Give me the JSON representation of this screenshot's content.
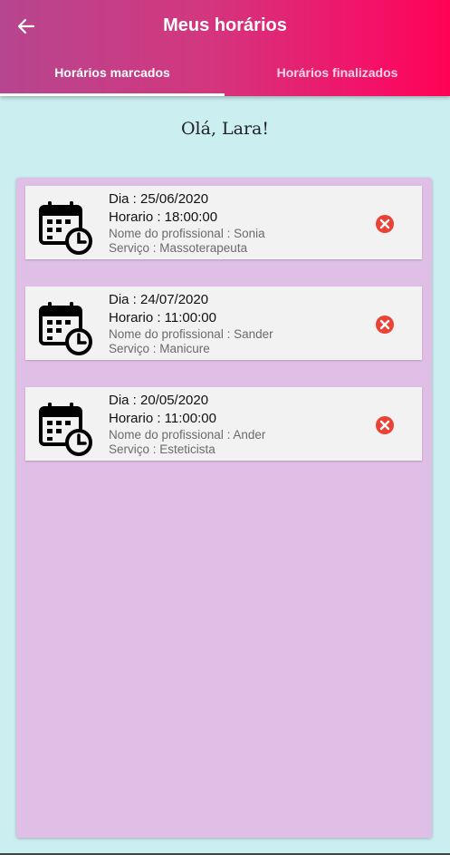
{
  "header": {
    "title": "Meus horários",
    "back_icon": "arrow-left-icon"
  },
  "tabs": [
    {
      "label": "Horários marcados",
      "active": true
    },
    {
      "label": "Horários finalizados",
      "active": false
    }
  ],
  "greeting": "Olá, Lara!",
  "appointments": [
    {
      "day": "Dia : 25/06/2020",
      "time": "Horario : 18:00:00",
      "professional": "Nome do profissional : Sonia",
      "service": "Serviço : Massoterapeuta"
    },
    {
      "day": "Dia : 24/07/2020",
      "time": "Horario : 11:00:00",
      "professional": "Nome do profissional : Sander",
      "service": "Serviço : Manicure"
    },
    {
      "day": "Dia : 20/05/2020",
      "time": "Horario : 11:00:00",
      "professional": "Nome do profissional : Ander",
      "service": "Serviço : Esteticista"
    }
  ],
  "colors": {
    "background": "#cbeef1",
    "panel": "#e0bfe7",
    "card": "#f2f2f2",
    "cancel": "#ea4335",
    "header_start": "#b6468f",
    "header_end": "#ff0255"
  }
}
